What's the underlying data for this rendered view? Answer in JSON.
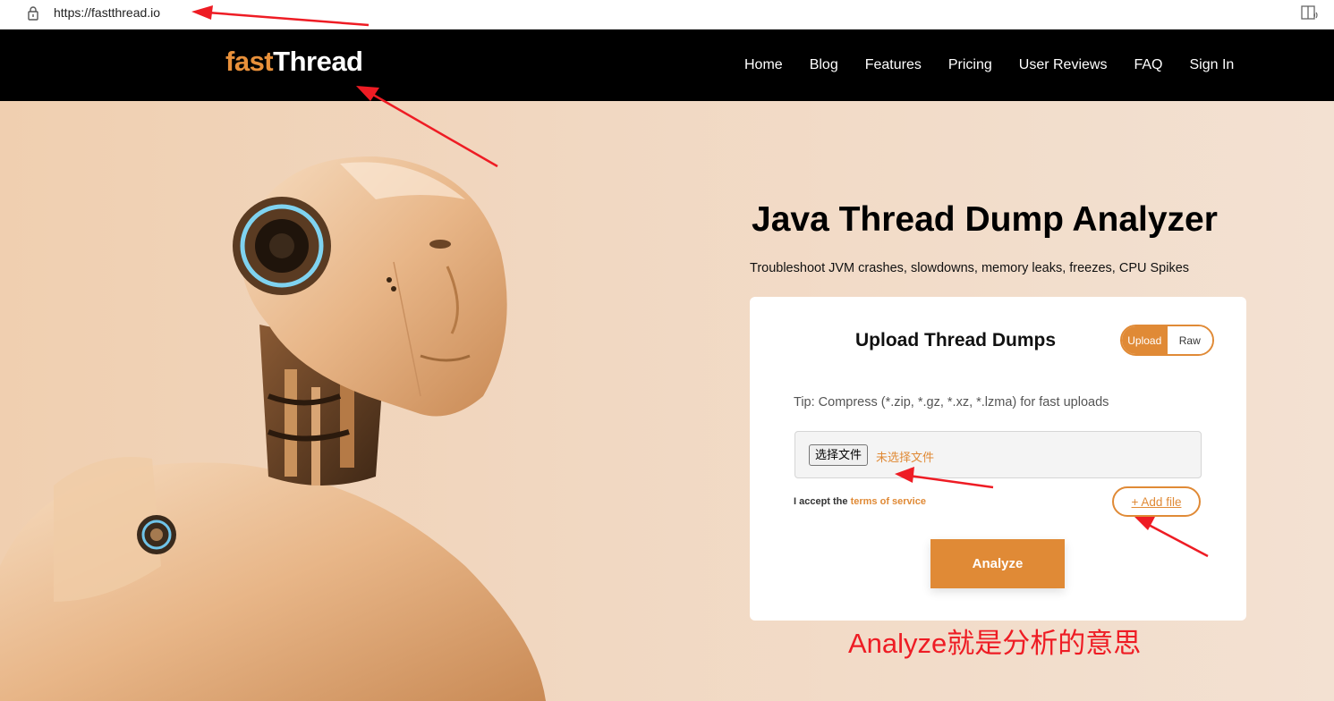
{
  "browser": {
    "url": "https://fastthread.io"
  },
  "nav": {
    "logo_part1": "fast",
    "logo_part2": "Thread",
    "links": [
      "Home",
      "Blog",
      "Features",
      "Pricing",
      "User Reviews",
      "FAQ",
      "Sign In"
    ]
  },
  "hero": {
    "title": "Java Thread Dump Analyzer",
    "subtitle": "Troubleshoot JVM crashes, slowdowns, memory leaks, freezes, CPU Spikes"
  },
  "upload": {
    "title": "Upload Thread Dumps",
    "toggle_upload": "Upload",
    "toggle_raw": "Raw",
    "tip": "Tip: Compress (*.zip, *.gz, *.xz, *.lzma) for fast uploads",
    "choose_file": "选择文件",
    "no_file": "未选择文件",
    "accept_prefix": "I accept the ",
    "terms_link": "terms of service",
    "add_file": "+ Add file",
    "analyze": "Analyze"
  },
  "annotation": {
    "note": "Analyze就是分析的意思",
    "color": "#ee1c24"
  },
  "colors": {
    "accent": "#e08a36",
    "nav_bg": "#000000"
  }
}
